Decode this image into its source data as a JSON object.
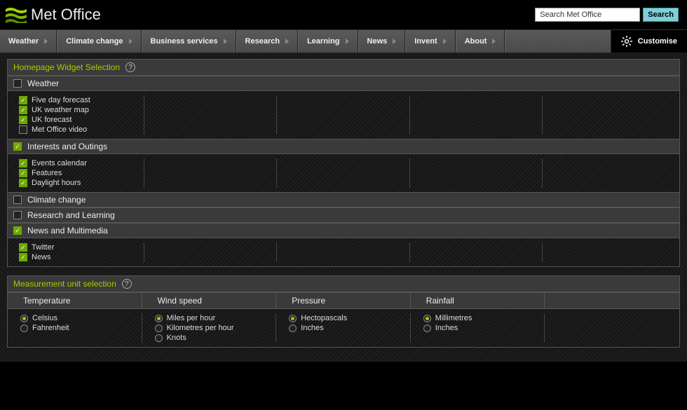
{
  "header": {
    "brand": "Met Office",
    "search_placeholder": "Search Met Office",
    "search_button": "Search"
  },
  "nav": {
    "items": [
      "Weather",
      "Climate change",
      "Business services",
      "Research",
      "Learning",
      "News",
      "Invent",
      "About"
    ],
    "customise": "Customise"
  },
  "widget_panel": {
    "title": "Homepage Widget Selection",
    "sections": [
      {
        "label": "Weather",
        "header_checked": false,
        "items": [
          {
            "label": "Five day forecast",
            "checked": true
          },
          {
            "label": "UK weather map",
            "checked": true
          },
          {
            "label": "UK forecast",
            "checked": true
          },
          {
            "label": "Met Office video",
            "checked": false
          }
        ]
      },
      {
        "label": "Interests and Outings",
        "header_checked": true,
        "items": [
          {
            "label": "Events calendar",
            "checked": true
          },
          {
            "label": "Features",
            "checked": true
          },
          {
            "label": "Daylight hours",
            "checked": true
          }
        ]
      },
      {
        "label": "Climate change",
        "header_checked": false,
        "items": []
      },
      {
        "label": "Research and Learning",
        "header_checked": false,
        "items": []
      },
      {
        "label": "News and Multimedia",
        "header_checked": true,
        "items": [
          {
            "label": "Twitter",
            "checked": true
          },
          {
            "label": "News",
            "checked": true
          }
        ]
      }
    ]
  },
  "units_panel": {
    "title": "Measurement unit selection",
    "groups": [
      {
        "label": "Temperature",
        "options": [
          {
            "label": "Celsius",
            "selected": true
          },
          {
            "label": "Fahrenheit",
            "selected": false
          }
        ]
      },
      {
        "label": "Wind speed",
        "options": [
          {
            "label": "Miles per hour",
            "selected": true
          },
          {
            "label": "Kilometres per hour",
            "selected": false
          },
          {
            "label": "Knots",
            "selected": false
          }
        ]
      },
      {
        "label": "Pressure",
        "options": [
          {
            "label": "Hectopascals",
            "selected": true
          },
          {
            "label": "Inches",
            "selected": false
          }
        ]
      },
      {
        "label": "Rainfall",
        "options": [
          {
            "label": "Millimetres",
            "selected": true
          },
          {
            "label": "Inches",
            "selected": false
          }
        ]
      }
    ]
  }
}
